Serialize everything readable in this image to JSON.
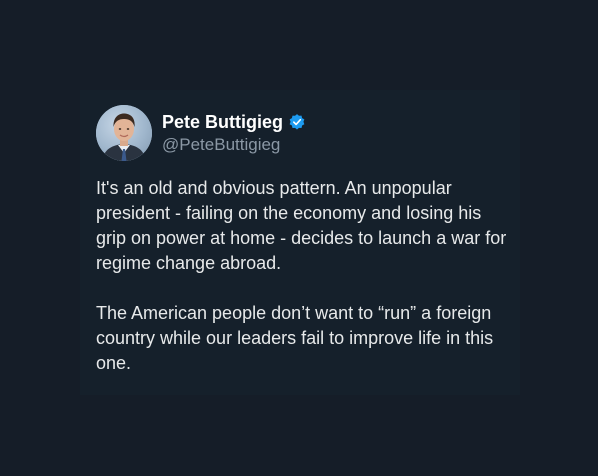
{
  "author": {
    "display_name": "Pete Buttigieg",
    "handle": "@PeteButtigieg",
    "verified": true,
    "verified_color": "#1d9bf0",
    "avatar_icon": "profile-photo"
  },
  "tweet": {
    "paragraphs": [
      "It's an old and obvious pattern. An unpopular president - failing on the economy and losing his grip on power at home - decides to launch a war for regime change abroad.",
      "The American people don’t want to “run” a foreign country while our leaders fail to improve life in this one."
    ]
  },
  "colors": {
    "background": "#151d28",
    "text": "#e7e9ea",
    "secondary_text": "#8b98a5"
  }
}
